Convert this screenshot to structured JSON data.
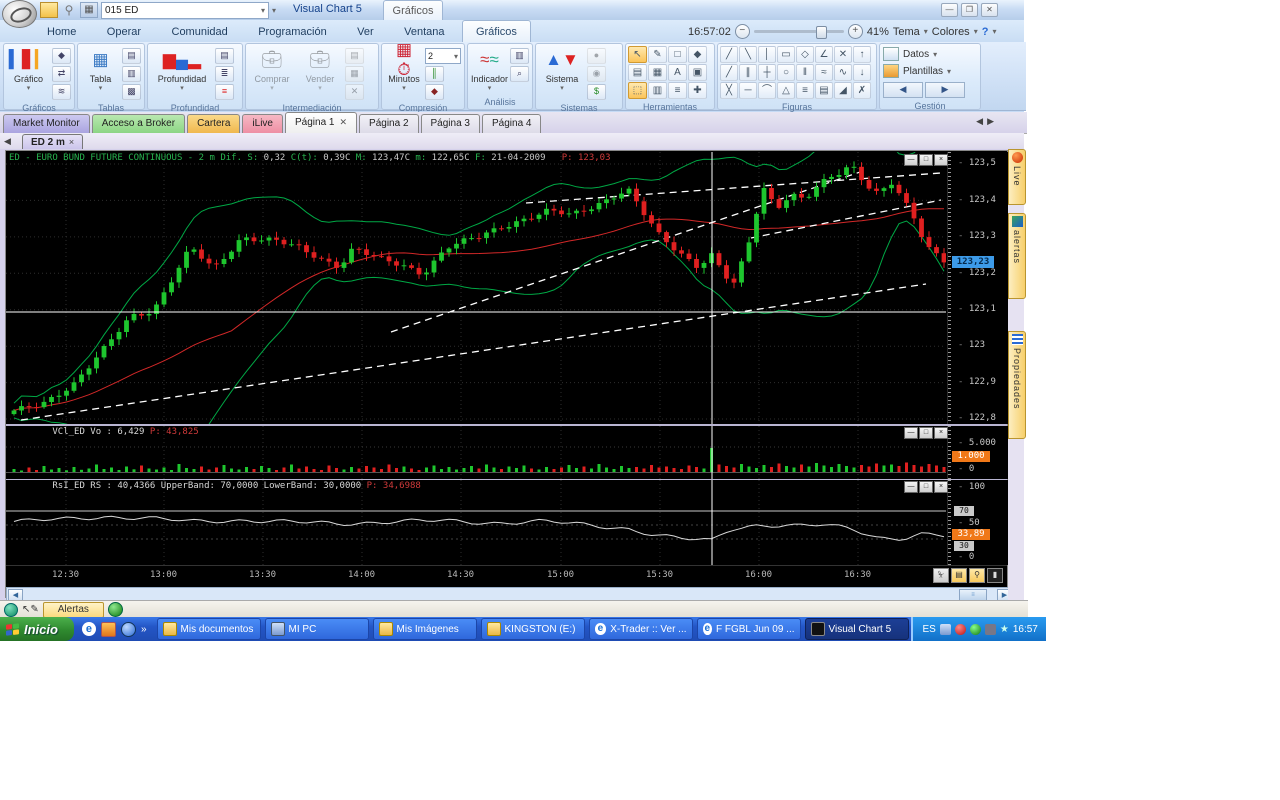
{
  "window": {
    "title": "Visual Chart 5",
    "quick_combo": "015 ED",
    "min": "—",
    "max": "❐",
    "close": "✕",
    "context_tab": "Gráficos"
  },
  "menu": {
    "tabs": [
      "Home",
      "Operar",
      "Comunidad",
      "Programación",
      "Ver",
      "Ventana",
      "Gráficos"
    ],
    "clock": "16:57:02",
    "zoom_level": "41%",
    "tema": "Tema",
    "colores": "Colores",
    "help": "?"
  },
  "ribbon": {
    "groups": [
      {
        "label": "Gráficos",
        "big0": "Gráfico"
      },
      {
        "label": "Tablas",
        "big0": "Tabla"
      },
      {
        "label": "Profundidad",
        "big0": "Profundidad"
      },
      {
        "label": "Intermediación",
        "big0": "Comprar",
        "big1": "Vender"
      },
      {
        "label": "Compresión",
        "big0": "Minutos",
        "combo_value": "2"
      },
      {
        "label": "Análisis",
        "big0": "Indicador"
      },
      {
        "label": "Sistemas",
        "big0": "Sistema"
      },
      {
        "label": "Herramientas"
      },
      {
        "label": "Figuras"
      },
      {
        "label": "Gestión",
        "big0": "Datos",
        "big1": "Plantillas"
      }
    ]
  },
  "icons": {
    "herramientas": [
      "↖",
      "✎",
      "□",
      "◆",
      "▤",
      "▦",
      "A",
      "▣",
      "⬚",
      "▥",
      "≡",
      "✚"
    ],
    "figuras": [
      "╱",
      "╲",
      "│",
      "▭",
      "◇",
      "∠",
      "✕",
      "↑",
      "╱",
      "∥",
      "┼",
      "○",
      "‖",
      "≈",
      "∿",
      "↓",
      "╳",
      "─",
      "⌒",
      "△",
      "≡",
      "▤",
      "◢",
      "✗"
    ]
  },
  "page_tabs": [
    "Market Monitor",
    "Acceso a Broker",
    "Cartera",
    "iLive",
    "Página 1",
    "Página 2",
    "Página 3",
    "Página 4"
  ],
  "doc_tab": {
    "label": "ED 2 m",
    "close": "×"
  },
  "panes": {
    "volume_label": "VCl_ED Vo : 6,429",
    "volume_value": "P: 43,825",
    "rsi_label": "RsI_ED RS : 40,4366 UpperBand: 70,0000 LowerBand: 30,0000",
    "rsi_value": "P: 34,6988"
  },
  "price_axis": {
    "labels": [
      "123,5",
      "123,4",
      "123,3",
      "123,2",
      "123,1",
      "123",
      "122,9",
      "122,8"
    ],
    "last": "123,23"
  },
  "volume_axis": {
    "top": "5.000",
    "zero": "0",
    "current": "1.000"
  },
  "rsi_axis": {
    "l100": "100",
    "l70": "70",
    "l50": "50",
    "l30": "30",
    "l0": "0",
    "current": "33,89"
  },
  "sidebar": {
    "tabs": [
      "Live",
      "alertas",
      "Propiedades"
    ]
  },
  "status": {
    "alerts": "Alertas"
  },
  "taskbar": {
    "start": "Inicio",
    "more": "»",
    "buttons": [
      "Mis documentos",
      "MI PC",
      "Mis Imágenes",
      "KINGSTON (E:)",
      "X-Trader :: Ver ...",
      "F FGBL Jun 09 ...",
      "Visual Chart 5"
    ],
    "lang": "ES",
    "time": "16:57"
  },
  "chart_data": {
    "type": "candlestick",
    "symbol": "ED - EURO BUND FUTURE CONTINUOUS",
    "compression": "2 m",
    "session_date": "21-04-2009",
    "title_segments": [
      {
        "text": "ED - EURO BUND FUTURE CONTINUOUS - 2 m Dif. S:",
        "color": "#27b34f"
      },
      {
        "text": " 0,32",
        "color": "#c8c8c8"
      },
      {
        "text": " C(t):",
        "color": "#27b34f"
      },
      {
        "text": " 0,39C",
        "color": "#c8c8c8"
      },
      {
        "text": " M:",
        "color": "#27b34f"
      },
      {
        "text": " 123,47C",
        "color": "#c8c8c8"
      },
      {
        "text": " m:",
        "color": "#27b34f"
      },
      {
        "text": " 122,65C",
        "color": "#c8c8c8"
      },
      {
        "text": " F:",
        "color": "#27b34f"
      },
      {
        "text": " 21-04-2009",
        "color": "#c8c8c8"
      },
      {
        "text": "   P: 123,03",
        "color": "#d03a3a"
      }
    ],
    "ylim": [
      122.8,
      123.5
    ],
    "time_labels": [
      "12:30",
      "13:00",
      "13:30",
      "14:00",
      "14:30",
      "15:00",
      "15:30",
      "16:00",
      "16:30"
    ],
    "time_tick_x": [
      60,
      158,
      257,
      356,
      455,
      555,
      654,
      753,
      852
    ],
    "price_ticks": [
      123.5,
      123.4,
      123.3,
      123.2,
      123.1,
      123.0,
      122.9,
      122.8
    ],
    "last_price": 123.23,
    "price_path": [
      [
        0.0,
        122.82
      ],
      [
        0.03,
        122.84
      ],
      [
        0.065,
        122.9
      ],
      [
        0.1,
        123.0
      ],
      [
        0.125,
        123.08
      ],
      [
        0.15,
        123.1
      ],
      [
        0.19,
        123.27
      ],
      [
        0.215,
        123.21
      ],
      [
        0.245,
        123.3
      ],
      [
        0.28,
        123.29
      ],
      [
        0.305,
        123.27
      ],
      [
        0.33,
        123.24
      ],
      [
        0.35,
        123.22
      ],
      [
        0.365,
        123.27
      ],
      [
        0.39,
        123.24
      ],
      [
        0.42,
        123.22
      ],
      [
        0.44,
        123.2
      ],
      [
        0.465,
        123.27
      ],
      [
        0.5,
        123.3
      ],
      [
        0.525,
        123.33
      ],
      [
        0.55,
        123.35
      ],
      [
        0.575,
        123.37
      ],
      [
        0.6,
        123.36
      ],
      [
        0.635,
        123.4
      ],
      [
        0.66,
        123.43
      ],
      [
        0.675,
        123.37
      ],
      [
        0.695,
        123.3
      ],
      [
        0.715,
        123.26
      ],
      [
        0.735,
        123.22
      ],
      [
        0.75,
        123.25
      ],
      [
        0.765,
        123.19
      ],
      [
        0.775,
        123.17
      ],
      [
        0.79,
        123.28
      ],
      [
        0.805,
        123.44
      ],
      [
        0.82,
        123.38
      ],
      [
        0.835,
        123.42
      ],
      [
        0.85,
        123.4
      ],
      [
        0.865,
        123.44
      ],
      [
        0.885,
        123.47
      ],
      [
        0.9,
        123.5
      ],
      [
        0.915,
        123.45
      ],
      [
        0.93,
        123.42
      ],
      [
        0.945,
        123.45
      ],
      [
        0.965,
        123.36
      ],
      [
        0.98,
        123.28
      ],
      [
        1.0,
        123.23
      ]
    ],
    "volumes": [
      600,
      300,
      900,
      400,
      1200,
      500,
      800,
      350,
      1000,
      450,
      700,
      1500,
      600,
      900,
      400,
      1100,
      550,
      1300,
      700,
      500,
      900,
      400,
      1600,
      800,
      600,
      1100,
      500,
      900,
      1400,
      700,
      500,
      1000,
      600,
      1200,
      800,
      400,
      900,
      1500,
      700,
      1100,
      600,
      400,
      1300,
      800,
      500,
      1000,
      700,
      1200,
      900,
      600,
      1500,
      800,
      1100,
      700,
      400,
      900,
      1300,
      600,
      1000,
      500,
      800,
      1200,
      700,
      1500,
      900,
      600,
      1100,
      800,
      1300,
      700,
      500,
      1000,
      600,
      900,
      1400,
      800,
      1100,
      700,
      1600,
      900,
      600,
      1200,
      800,
      1000,
      700,
      1400,
      900,
      1100,
      800,
      600,
      1300,
      1000,
      700,
      4800,
      1500,
      1200,
      900,
      1600,
      1100,
      800,
      1400,
      1000,
      1700,
      1200,
      900,
      1500,
      1100,
      1800,
      1300,
      1000,
      1600,
      1200,
      900,
      1400,
      1100,
      1700,
      1300,
      1500,
      1200,
      1900,
      1400,
      1100,
      1600,
      1300,
      1000
    ],
    "rsi_path": [
      [
        0,
        55
      ],
      [
        0.05,
        58
      ],
      [
        0.1,
        62
      ],
      [
        0.14,
        60
      ],
      [
        0.19,
        55
      ],
      [
        0.25,
        57
      ],
      [
        0.3,
        54
      ],
      [
        0.35,
        52
      ],
      [
        0.41,
        55
      ],
      [
        0.46,
        56
      ],
      [
        0.52,
        53
      ],
      [
        0.57,
        55
      ],
      [
        0.62,
        50
      ],
      [
        0.66,
        45
      ],
      [
        0.69,
        35
      ],
      [
        0.72,
        30
      ],
      [
        0.75,
        28
      ],
      [
        0.77,
        45
      ],
      [
        0.8,
        50
      ],
      [
        0.84,
        48
      ],
      [
        0.87,
        50
      ],
      [
        0.9,
        46
      ],
      [
        0.93,
        32
      ],
      [
        0.955,
        30
      ],
      [
        0.975,
        36
      ],
      [
        1,
        34
      ]
    ],
    "rsi_bands": {
      "upper": 70,
      "mid": 50,
      "lower": 30
    },
    "trendlines": [
      [
        15,
        268,
        920,
        132
      ],
      [
        385,
        180,
        860,
        18
      ],
      [
        520,
        51,
        935,
        21
      ],
      [
        745,
        86,
        935,
        48
      ]
    ],
    "crosshair": {
      "x": 706,
      "y": 160
    },
    "colors": {
      "up": "#1ec62e",
      "down": "#e02020",
      "band": "#00a845",
      "ma": "#d22828",
      "rsi": "#d8d8d8",
      "grid": "#2e2e2e",
      "trend": "#ffffff"
    }
  }
}
